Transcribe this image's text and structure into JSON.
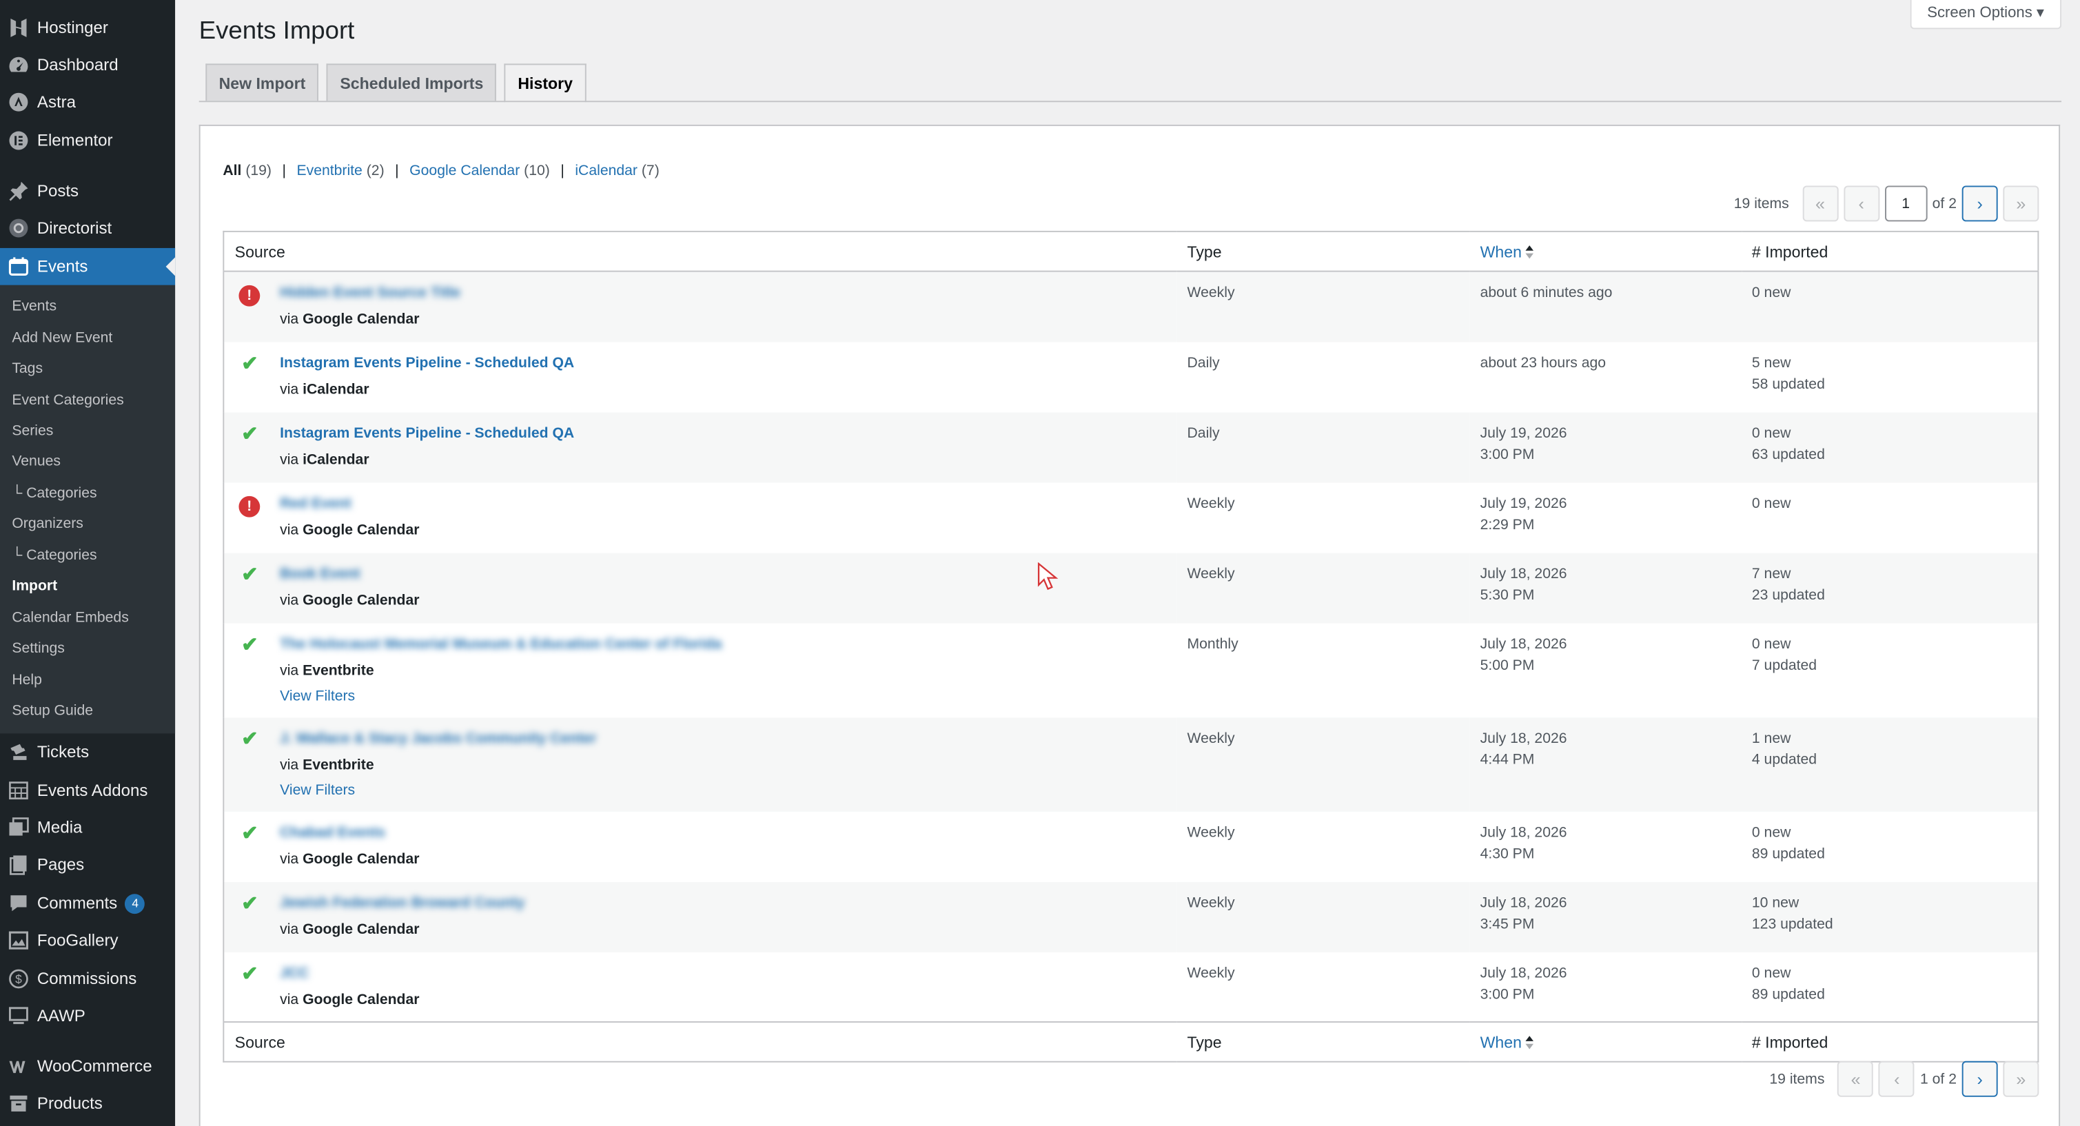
{
  "sidebar": {
    "top_items": [
      {
        "label": "Hostinger",
        "icon": "hostinger-icon"
      },
      {
        "label": "Dashboard",
        "icon": "dashboard-icon"
      },
      {
        "label": "Astra",
        "icon": "astra-icon"
      },
      {
        "label": "Elementor",
        "icon": "elementor-icon"
      },
      {
        "label": "Posts",
        "icon": "pin-icon"
      },
      {
        "label": "Directorist",
        "icon": "directorist-icon"
      },
      {
        "label": "Events",
        "icon": "calendar-icon"
      }
    ],
    "sub_items": [
      "Events",
      "Add New Event",
      "Tags",
      "Event Categories",
      "Series",
      "Venues",
      "└ Categories",
      "Organizers",
      "└ Categories",
      "Import",
      "Calendar Embeds",
      "Settings",
      "Help",
      "Setup Guide"
    ],
    "bottom_items": [
      {
        "label": "Tickets",
        "icon": "ticket-icon"
      },
      {
        "label": "Events Addons",
        "icon": "grid-calendar-icon"
      },
      {
        "label": "Media",
        "icon": "media-icon"
      },
      {
        "label": "Pages",
        "icon": "pages-icon"
      },
      {
        "label": "Comments",
        "icon": "comment-icon",
        "badge": "4"
      },
      {
        "label": "FooGallery",
        "icon": "gallery-icon"
      },
      {
        "label": "Commissions",
        "icon": "dollar-icon"
      },
      {
        "label": "AAWP",
        "icon": "monitor-icon"
      },
      {
        "label": "WooCommerce",
        "icon": "woocommerce-icon"
      },
      {
        "label": "Products",
        "icon": "archive-icon"
      }
    ]
  },
  "header": {
    "screen_options": "Screen Options ▾",
    "title": "Events Import",
    "tabs": [
      "New Import",
      "Scheduled Imports",
      "History"
    ]
  },
  "filters": {
    "all": "All",
    "all_count": "(19)",
    "eventbrite": "Eventbrite",
    "eventbrite_count": "(2)",
    "google": "Google Calendar",
    "google_count": "(10)",
    "ical": "iCalendar",
    "ical_count": "(7)",
    "sep": "|"
  },
  "pagination": {
    "items": "19 items",
    "first": "«",
    "prev": "‹",
    "next": "›",
    "last": "»",
    "current": "1",
    "of": "of 2",
    "bottom_label": "1 of 2"
  },
  "table": {
    "headers": {
      "source": "Source",
      "type": "Type",
      "when": "When",
      "imported": "# Imported"
    },
    "rows": [
      {
        "status": "error",
        "source": "Hidden Event Source Title",
        "via_prefix": "via",
        "via": "Google Calendar",
        "type": "Weekly",
        "when1": "about 6 minutes ago",
        "when2": "",
        "imp1": "0 new",
        "imp2": "",
        "filters": "",
        "blurred": true
      },
      {
        "status": "ok",
        "source": "Instagram Events Pipeline - Scheduled QA",
        "via_prefix": "via",
        "via": "iCalendar",
        "type": "Daily",
        "when1": "about 23 hours ago",
        "when2": "",
        "imp1": "5 new",
        "imp2": "58 updated",
        "filters": "",
        "blurred": false
      },
      {
        "status": "ok",
        "source": "Instagram Events Pipeline - Scheduled QA",
        "via_prefix": "via",
        "via": "iCalendar",
        "type": "Daily",
        "when1": "July 19, 2026",
        "when2": "3:00 PM",
        "imp1": "0 new",
        "imp2": "63 updated",
        "filters": "",
        "blurred": false
      },
      {
        "status": "error",
        "source": "Red Event",
        "via_prefix": "via",
        "via": "Google Calendar",
        "type": "Weekly",
        "when1": "July 19, 2026",
        "when2": "2:29 PM",
        "imp1": "0 new",
        "imp2": "",
        "filters": "",
        "blurred": true
      },
      {
        "status": "ok",
        "source": "Book Event",
        "via_prefix": "via",
        "via": "Google Calendar",
        "type": "Weekly",
        "when1": "July 18, 2026",
        "when2": "5:30 PM",
        "imp1": "7 new",
        "imp2": "23 updated",
        "filters": "",
        "blurred": true
      },
      {
        "status": "ok",
        "source": "The Holocaust Memorial Museum & Education Center of Florida",
        "via_prefix": "via",
        "via": "Eventbrite",
        "type": "Monthly",
        "when1": "July 18, 2026",
        "when2": "5:00 PM",
        "imp1": "0 new",
        "imp2": "7 updated",
        "filters": "View Filters",
        "blurred": true
      },
      {
        "status": "ok",
        "source": "J. Wallace & Stacy Jacobs Community Center",
        "via_prefix": "via",
        "via": "Eventbrite",
        "type": "Weekly",
        "when1": "July 18, 2026",
        "when2": "4:44 PM",
        "imp1": "1 new",
        "imp2": "4 updated",
        "filters": "View Filters",
        "blurred": true
      },
      {
        "status": "ok",
        "source": "Chabad Events",
        "via_prefix": "via",
        "via": "Google Calendar",
        "type": "Weekly",
        "when1": "July 18, 2026",
        "when2": "4:30 PM",
        "imp1": "0 new",
        "imp2": "89 updated",
        "filters": "",
        "blurred": true
      },
      {
        "status": "ok",
        "source": "Jewish Federation Broward County",
        "via_prefix": "via",
        "via": "Google Calendar",
        "type": "Weekly",
        "when1": "July 18, 2026",
        "when2": "3:45 PM",
        "imp1": "10 new",
        "imp2": "123 updated",
        "filters": "",
        "blurred": true
      },
      {
        "status": "ok",
        "source": "JCC",
        "via_prefix": "via",
        "via": "Google Calendar",
        "type": "Weekly",
        "when1": "July 18, 2026",
        "when2": "3:00 PM",
        "imp1": "0 new",
        "imp2": "89 updated",
        "filters": "",
        "blurred": true
      }
    ]
  },
  "colors": {
    "accent": "#2271b1",
    "sidebar": "#1d2327",
    "submenu": "#2c3338",
    "success": "#46b450",
    "error": "#d63638"
  }
}
